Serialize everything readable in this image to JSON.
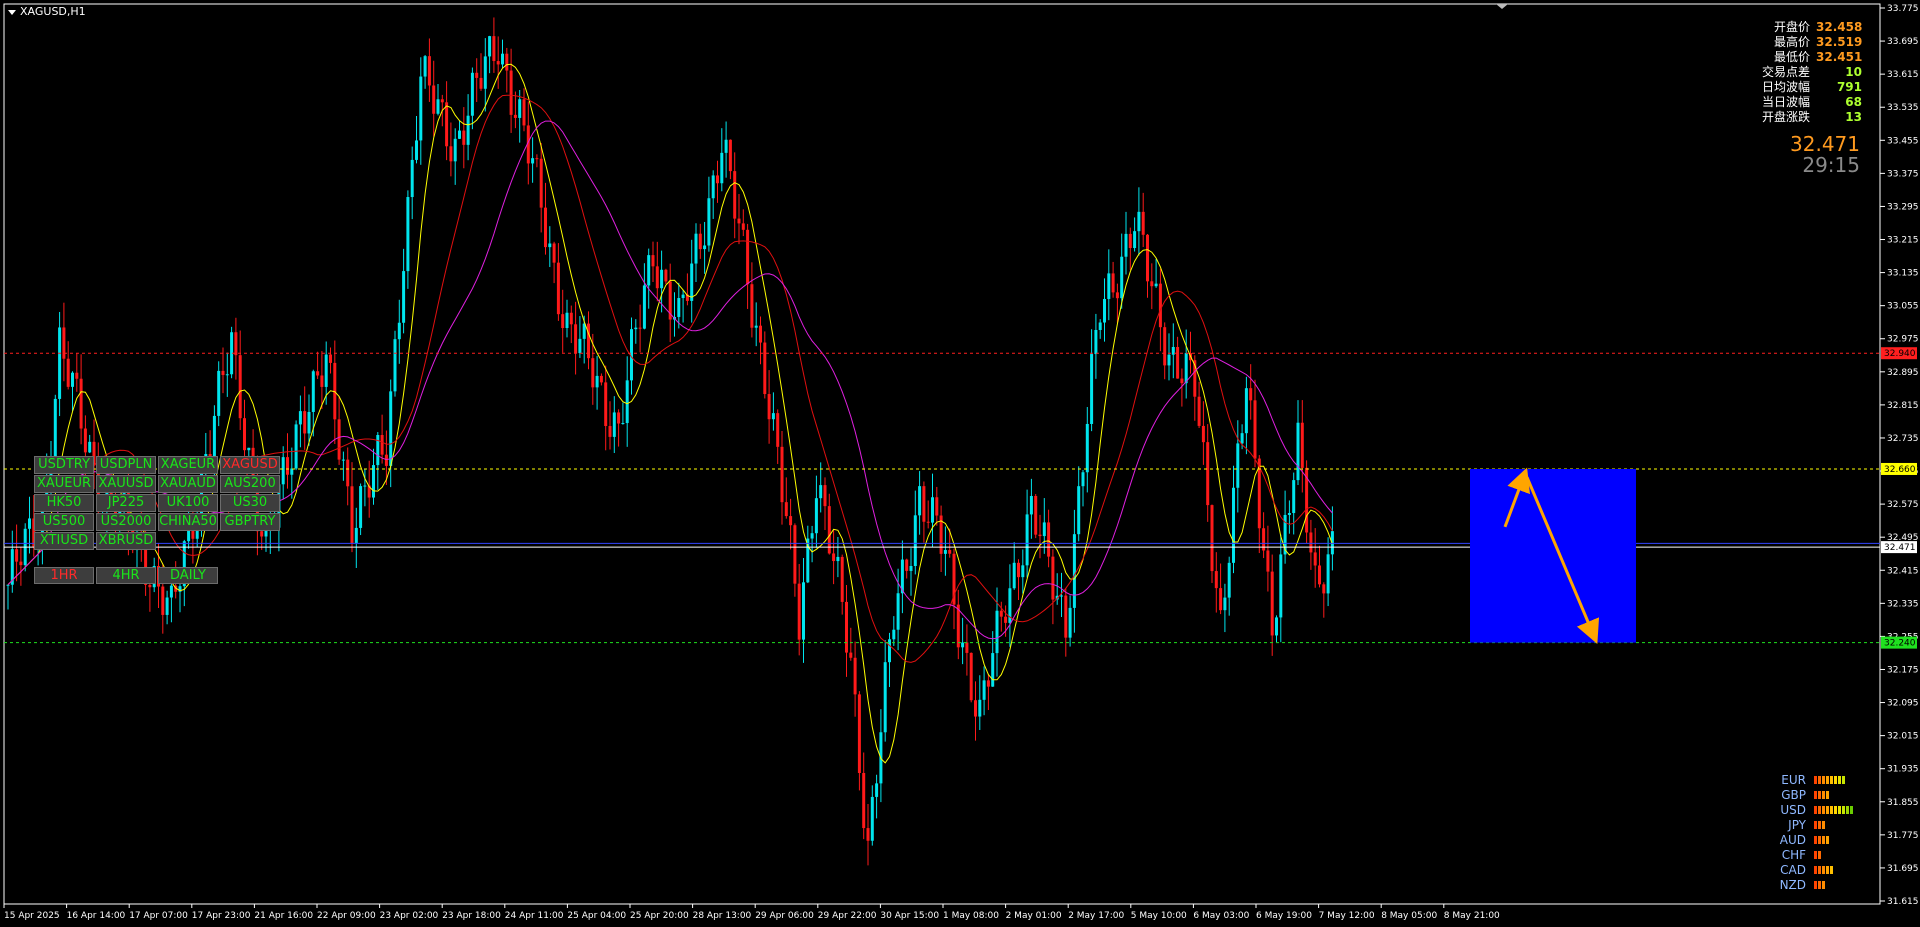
{
  "chart": {
    "symbol_title": "XAGUSD,H1",
    "y_ticks": [
      "33.775",
      "33.695",
      "33.615",
      "33.535",
      "33.455",
      "33.375",
      "33.295",
      "33.215",
      "33.135",
      "33.055",
      "32.975",
      "32.895",
      "32.815",
      "32.735",
      "32.655",
      "32.575",
      "32.495",
      "32.415",
      "32.335",
      "32.255",
      "32.175",
      "32.095",
      "32.015",
      "31.935",
      "31.855",
      "31.775",
      "31.695",
      "31.615"
    ],
    "x_ticks": [
      "15 Apr 2025",
      "16 Apr 14:00",
      "17 Apr 07:00",
      "17 Apr 23:00",
      "21 Apr 16:00",
      "22 Apr 09:00",
      "23 Apr 02:00",
      "23 Apr 18:00",
      "24 Apr 11:00",
      "25 Apr 04:00",
      "25 Apr 20:00",
      "28 Apr 13:00",
      "29 Apr 06:00",
      "29 Apr 22:00",
      "30 Apr 15:00",
      "1 May 08:00",
      "2 May 01:00",
      "2 May 17:00",
      "5 May 10:00",
      "6 May 03:00",
      "6 May 19:00",
      "7 May 12:00",
      "8 May 05:00",
      "8 May 21:00"
    ],
    "price_markers": [
      {
        "label": "32.940",
        "bg": "#ff1f1f",
        "fg": "#000000",
        "price": 32.94
      },
      {
        "label": "32.660",
        "bg": "#ffff00",
        "fg": "#000000",
        "price": 32.66
      },
      {
        "label": "32.471",
        "bg": "#ffffff",
        "fg": "#000000",
        "price": 32.471
      },
      {
        "label": "32.240",
        "bg": "#1fe11f",
        "fg": "#000000",
        "price": 32.24
      }
    ],
    "colors": {
      "bull": "#00e5ee",
      "bear": "#ff1a1a",
      "ma_fast": "#ffff00",
      "ma_mid": "#e01010",
      "ma_slow": "#e020e0",
      "box": "#0000ff",
      "arrow": "#ffa500"
    }
  },
  "stats": [
    {
      "label": "开盘价",
      "value": "32.458",
      "color": "#ff9a1f"
    },
    {
      "label": "最高价",
      "value": "32.519",
      "color": "#ff9a1f"
    },
    {
      "label": "最低价",
      "value": "32.451",
      "color": "#ff9a1f"
    },
    {
      "label": "交易点差",
      "value": "10",
      "color": "#adff2f"
    },
    {
      "label": "日均波幅",
      "value": "791",
      "color": "#adff2f"
    },
    {
      "label": "当日波幅",
      "value": "68",
      "color": "#adff2f"
    },
    {
      "label": "开盘涨跌",
      "value": "13",
      "color": "#adff2f"
    }
  ],
  "price_display": {
    "price": "32.471",
    "timer": "29:15"
  },
  "symbols": [
    {
      "label": "USDTRY",
      "active": false
    },
    {
      "label": "USDPLN",
      "active": false
    },
    {
      "label": "XAGEUR",
      "active": false
    },
    {
      "label": "XAGUSD",
      "active": true
    },
    {
      "label": "XAUEUR",
      "active": false
    },
    {
      "label": "XAUUSD",
      "active": false
    },
    {
      "label": "XAUAUD",
      "active": false
    },
    {
      "label": "AUS200",
      "active": false
    },
    {
      "label": "HK50",
      "active": false
    },
    {
      "label": "JP225",
      "active": false
    },
    {
      "label": "UK100",
      "active": false
    },
    {
      "label": "US30",
      "active": false
    },
    {
      "label": "US500",
      "active": false
    },
    {
      "label": "US2000",
      "active": false
    },
    {
      "label": "CHINA50",
      "active": false
    },
    {
      "label": "GBPTRY",
      "active": false
    },
    {
      "label": "XTIUSD",
      "active": false
    },
    {
      "label": "XBRUSD",
      "active": false
    }
  ],
  "timeframes": [
    {
      "label": "1HR",
      "active": true
    },
    {
      "label": "4HR",
      "active": false
    },
    {
      "label": "DAILY",
      "active": false
    }
  ],
  "strength": [
    {
      "currency": "EUR",
      "bars": [
        "#ff4500",
        "#ff6a00",
        "#ff8c00",
        "#ffa500",
        "#ffc000",
        "#ffd700",
        "#e6e600",
        "#c8e600"
      ]
    },
    {
      "currency": "GBP",
      "bars": [
        "#ff4500",
        "#ff6a00",
        "#ff8c00",
        "#ffa500"
      ]
    },
    {
      "currency": "USD",
      "bars": [
        "#ff4500",
        "#ff6a00",
        "#ff8c00",
        "#ffa500",
        "#ffc000",
        "#ffd700",
        "#e6e600",
        "#c8e600",
        "#9ad600",
        "#6acd00"
      ]
    },
    {
      "currency": "JPY",
      "bars": [
        "#ff4500",
        "#ff6a00",
        "#ff8c00"
      ]
    },
    {
      "currency": "AUD",
      "bars": [
        "#ff4500",
        "#ff6a00",
        "#ff8c00",
        "#ffa500"
      ]
    },
    {
      "currency": "CHF",
      "bars": [
        "#ff4500",
        "#ff6a00"
      ]
    },
    {
      "currency": "CAD",
      "bars": [
        "#ff4500",
        "#ff6a00",
        "#ff8c00",
        "#ffa500",
        "#ffc000"
      ]
    },
    {
      "currency": "NZD",
      "bars": [
        "#ff4500",
        "#ff6a00",
        "#ff8c00"
      ]
    }
  ]
}
